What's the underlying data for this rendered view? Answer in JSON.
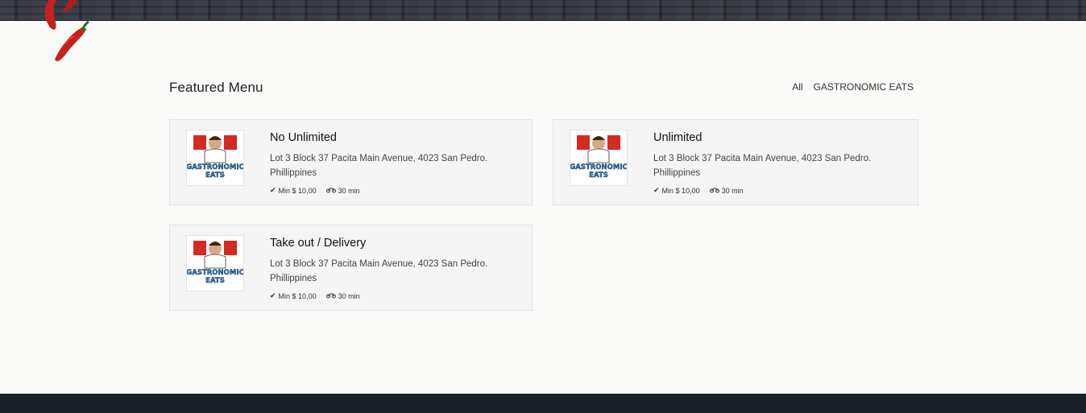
{
  "section": {
    "title": "Featured Menu"
  },
  "filters": [
    {
      "label": "All"
    },
    {
      "label": "GASTRONOMIC EATS"
    }
  ],
  "logo": {
    "brand_text_1": "GASTRONOMIC",
    "brand_text_2": "EATS"
  },
  "cards": [
    {
      "title": "No Unlimited",
      "address": "Lot 3 Block 37 Pacita Main Avenue, 4023 San Pedro. Phillippines",
      "min": "Min $ 10,00",
      "time": "30 min"
    },
    {
      "title": "Unlimited",
      "address": "Lot 3 Block 37 Pacita Main Avenue, 4023 San Pedro. Phillippines",
      "min": "Min $ 10,00",
      "time": "30 min"
    },
    {
      "title": "Take out / Delivery",
      "address": "Lot 3 Block 37 Pacita Main Avenue, 4023 San Pedro. Phillippines",
      "min": "Min $ 10,00",
      "time": "30 min"
    }
  ],
  "colors": {
    "header_bg": "#2b2f38",
    "footer_bg": "#1b1f2a",
    "chili_red": "#c8201e"
  }
}
